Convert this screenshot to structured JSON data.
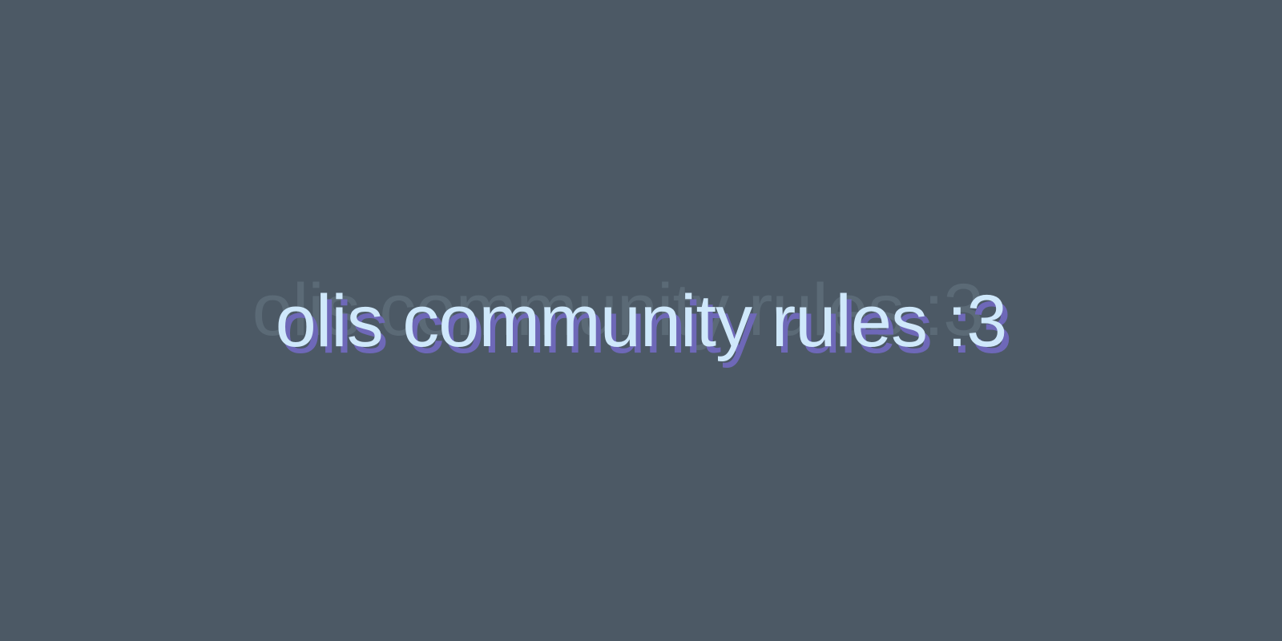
{
  "banner": {
    "title": "olis community rules :3"
  },
  "colors": {
    "background": "#4c5965",
    "title": "#cfe8fb",
    "title_shadow": "#6e68b8",
    "title_echo": "#5e6d7a"
  }
}
